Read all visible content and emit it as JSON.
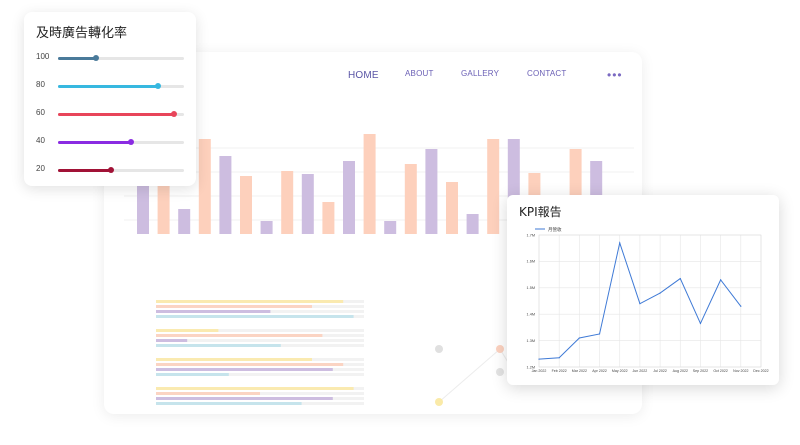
{
  "nav": {
    "home": "HOME",
    "about": "ABOUT",
    "gallery": "GALLERY",
    "contact": "CONTACT",
    "more": "•••"
  },
  "sliders": {
    "title": "及時廣告轉化率",
    "items": [
      {
        "label": "100",
        "value": 0.3,
        "color": "#4a7a9a"
      },
      {
        "label": "80",
        "value": 0.79,
        "color": "#37b8e0"
      },
      {
        "label": "60",
        "value": 0.92,
        "color": "#e8455a"
      },
      {
        "label": "40",
        "value": 0.58,
        "color": "#8a2be2"
      },
      {
        "label": "20",
        "value": 0.42,
        "color": "#a11236"
      }
    ]
  },
  "background_bars": {
    "purple": "#cdbde0",
    "peach": "#fdd0bc",
    "values": [
      0.6,
      0.6,
      0.25,
      0.95,
      0.78,
      0.58,
      0.13,
      0.63,
      0.6,
      0.32,
      0.73,
      1.0,
      0.13,
      0.7,
      0.85,
      0.52,
      0.2,
      0.95,
      0.95,
      0.61,
      0.22,
      0.85,
      0.73
    ]
  },
  "kpi": {
    "title": "KPI報告",
    "chart_data": {
      "type": "line",
      "series": [
        {
          "name": "月營收",
          "values": [
            1.23,
            1.235,
            1.31,
            1.325,
            1.67,
            1.44,
            1.48,
            1.535,
            1.365,
            1.53,
            1.43
          ]
        }
      ],
      "x": [
        "Jan 2022",
        "Feb 2022",
        "Mar 2022",
        "Apr 2022",
        "May 2022",
        "Jun 2022",
        "Jul 2022",
        "Aug 2022",
        "Sep 2022",
        "Oct 2022",
        "Nov 2022",
        "Dec 2022"
      ],
      "y_ticks": [
        "1.2M",
        "1.3M",
        "1.4M",
        "1.5M",
        "1.6M",
        "1.7M"
      ],
      "ylim": [
        1.2,
        1.7
      ],
      "line_color": "#3f7ad6",
      "grid": true,
      "legend": "top-left"
    }
  }
}
